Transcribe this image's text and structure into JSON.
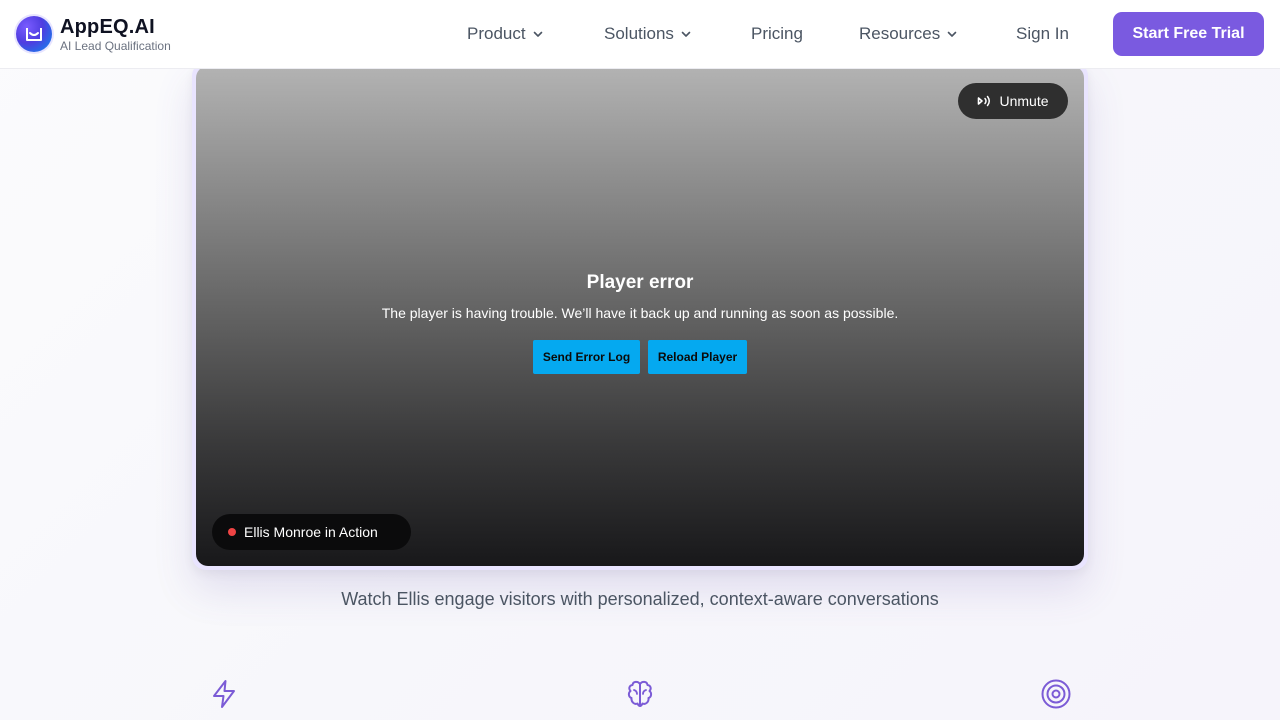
{
  "header": {
    "brand_name": "AppEQ.AI",
    "brand_tagline": "AI Lead Qualification",
    "logo_icon": "logo-icon",
    "nav": [
      {
        "label": "Product",
        "has_dropdown": true
      },
      {
        "label": "Solutions",
        "has_dropdown": true
      },
      {
        "label": "Pricing",
        "has_dropdown": false
      },
      {
        "label": "Resources",
        "has_dropdown": true
      }
    ],
    "sign_in": "Sign In",
    "cta": "Start Free Trial"
  },
  "video": {
    "unmute_label": "Unmute",
    "unmute_icon": "speaker-icon",
    "error_title": "Player error",
    "error_message": "The player is having trouble. We’ll have it back up and running as soon as possible.",
    "send_error_log": "Send Error Log",
    "reload_player": "Reload Player",
    "badge_label": "Ellis Monroe in Action"
  },
  "caption": "Watch Ellis engage visitors with personalized, context-aware conversations",
  "features": [
    {
      "icon": "lightning-icon"
    },
    {
      "icon": "brain-icon"
    },
    {
      "icon": "target-icon"
    }
  ],
  "colors": {
    "accent": "#7a5ae0",
    "error_button": "#05a9f0",
    "live_dot": "#ef4444",
    "icon_purple": "#7b5bd6"
  }
}
